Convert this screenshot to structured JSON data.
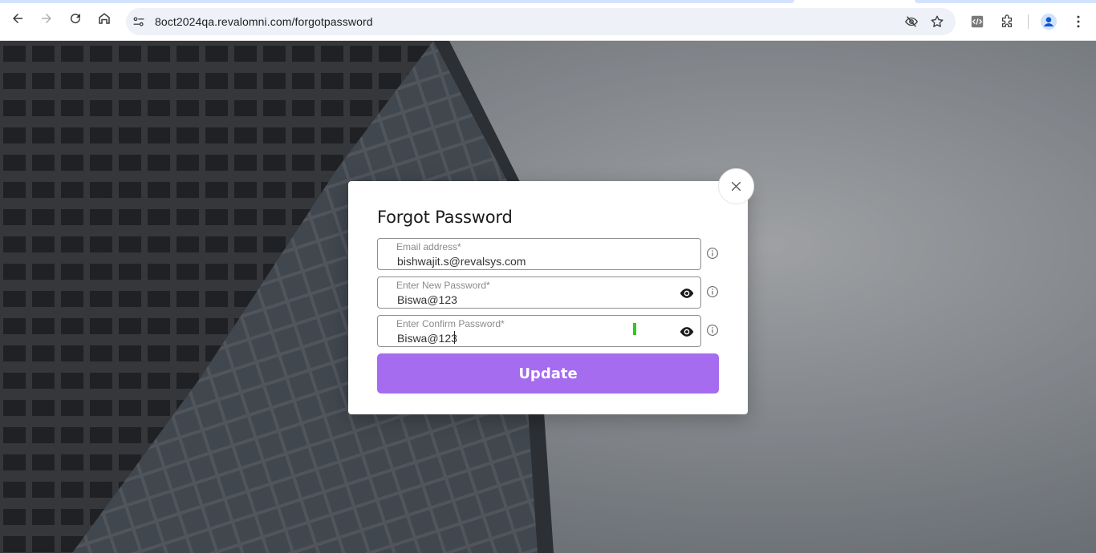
{
  "browser": {
    "url": "8oct2024qa.revalomni.com/forgotpassword",
    "icons": [
      "back-icon",
      "forward-icon",
      "reload-icon",
      "home-icon",
      "site-info-icon",
      "eye-off-icon",
      "star-icon",
      "devtools-icon",
      "extensions-icon",
      "profile-icon",
      "menu-icon"
    ]
  },
  "modal": {
    "title": "Forgot Password",
    "close_icon": "close-icon",
    "fields": [
      {
        "label": "Email address*",
        "value": "bishwajit.s@revalsys.com",
        "type": "text"
      },
      {
        "label": "Enter New Password*",
        "value": "Biswa@123",
        "type": "text"
      },
      {
        "label": "Enter Confirm Password*",
        "value": "Biswa@123",
        "type": "text"
      }
    ],
    "strength_color": "#2ecc1a",
    "submit_label": "Update",
    "accent_color": "#a66cf0"
  }
}
